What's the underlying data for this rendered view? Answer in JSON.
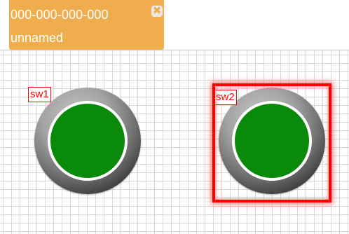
{
  "tab": {
    "id_text": "000-000-000-000",
    "name_text": "unnamed",
    "close_glyph": "✖",
    "color": "#f0ad4e"
  },
  "switches": [
    {
      "label": "sw1",
      "led_color": "#0a8a0a",
      "selected": false
    },
    {
      "label": "sw2",
      "led_color": "#0a8a0a",
      "selected": true
    }
  ],
  "selection_color": "#ff0000",
  "icons": {
    "close": "close-icon"
  }
}
